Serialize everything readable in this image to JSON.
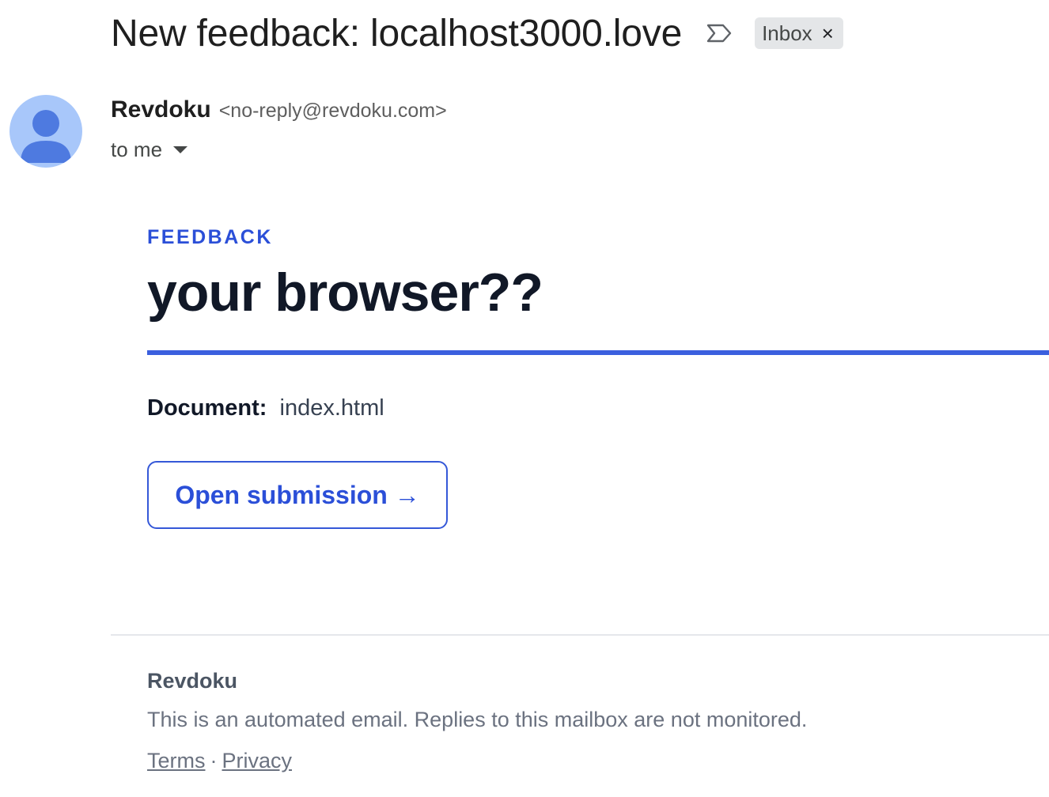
{
  "subject": {
    "title": "New feedback: localhost3000.love",
    "importance_icon": "important-marker-icon",
    "label": "Inbox",
    "label_remove": "×"
  },
  "sender": {
    "name": "Revdoku",
    "email": "<no-reply@revdoku.com>",
    "avatar_icon": "person-avatar-icon",
    "recipient": "to me",
    "recipient_icon": "caret-down-icon"
  },
  "body": {
    "kicker": "FEEDBACK",
    "headline": "your browser??",
    "document_label": "Document:",
    "document_value": "index.html",
    "open_button": "Open submission →"
  },
  "footer": {
    "brand": "Revdoku",
    "note": "This is an automated email. Replies to this mailbox are not monitored.",
    "terms": "Terms",
    "separator": "·",
    "privacy": "Privacy"
  },
  "colors": {
    "accent": "#2b4fd8",
    "rule": "#3b5fde",
    "avatar_bg": "#a8c7fa",
    "avatar_fg": "#4e7ae0",
    "chip_bg": "#e4e6e8"
  }
}
